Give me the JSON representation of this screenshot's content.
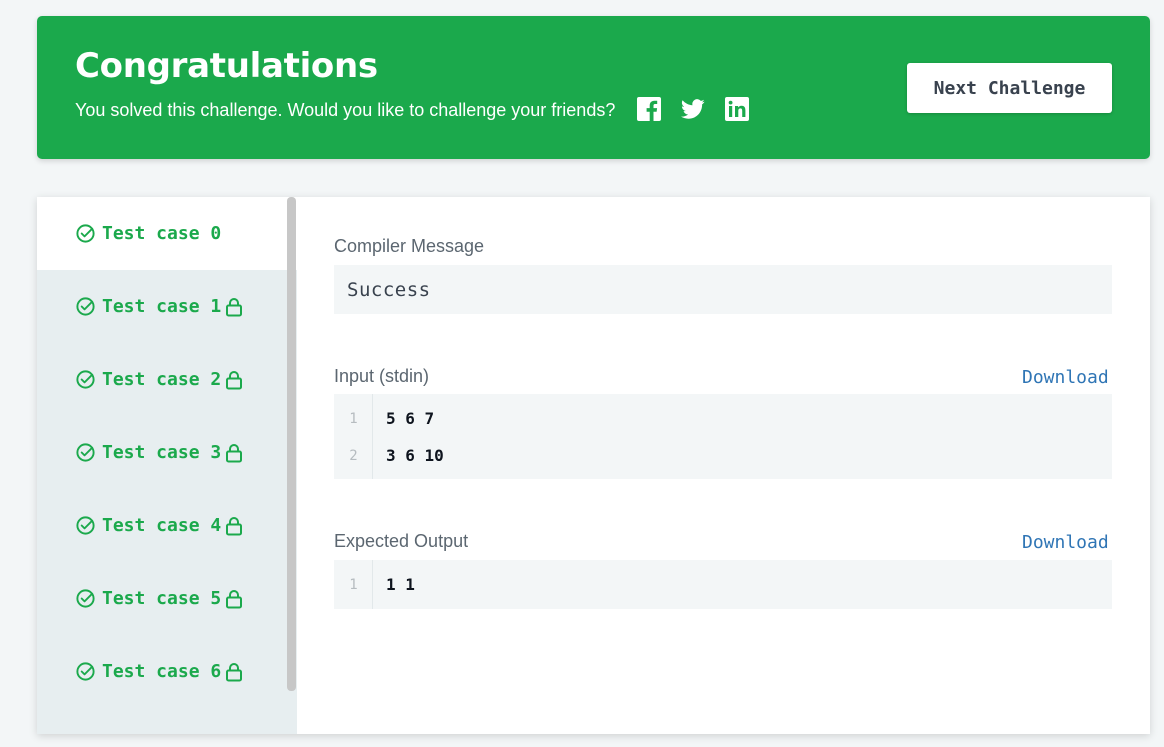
{
  "banner": {
    "title": "Congratulations",
    "subtitle": "You solved this challenge. Would you like to challenge your friends?",
    "share_icons": [
      "facebook-icon",
      "twitter-icon",
      "linkedin-icon"
    ],
    "next_button_label": "Next Challenge",
    "color": "#1ba94c"
  },
  "test_cases": [
    {
      "label": "Test case 0",
      "passed": true,
      "locked": false,
      "active": true
    },
    {
      "label": "Test case 1",
      "passed": true,
      "locked": true,
      "active": false
    },
    {
      "label": "Test case 2",
      "passed": true,
      "locked": true,
      "active": false
    },
    {
      "label": "Test case 3",
      "passed": true,
      "locked": true,
      "active": false
    },
    {
      "label": "Test case 4",
      "passed": true,
      "locked": true,
      "active": false
    },
    {
      "label": "Test case 5",
      "passed": true,
      "locked": true,
      "active": false
    },
    {
      "label": "Test case 6",
      "passed": true,
      "locked": true,
      "active": false
    }
  ],
  "compiler": {
    "label": "Compiler Message",
    "message": "Success"
  },
  "input": {
    "label": "Input (stdin)",
    "download_label": "Download",
    "lines": [
      {
        "no": "1",
        "text": "5 6 7"
      },
      {
        "no": "2",
        "text": "3 6 10"
      }
    ]
  },
  "expected": {
    "label": "Expected Output",
    "download_label": "Download",
    "lines": [
      {
        "no": "1",
        "text": "1 1"
      }
    ]
  },
  "colors": {
    "success_green": "#1ba94c",
    "link_blue": "#2f75b5",
    "sidebar_bg": "#e7eef0"
  }
}
